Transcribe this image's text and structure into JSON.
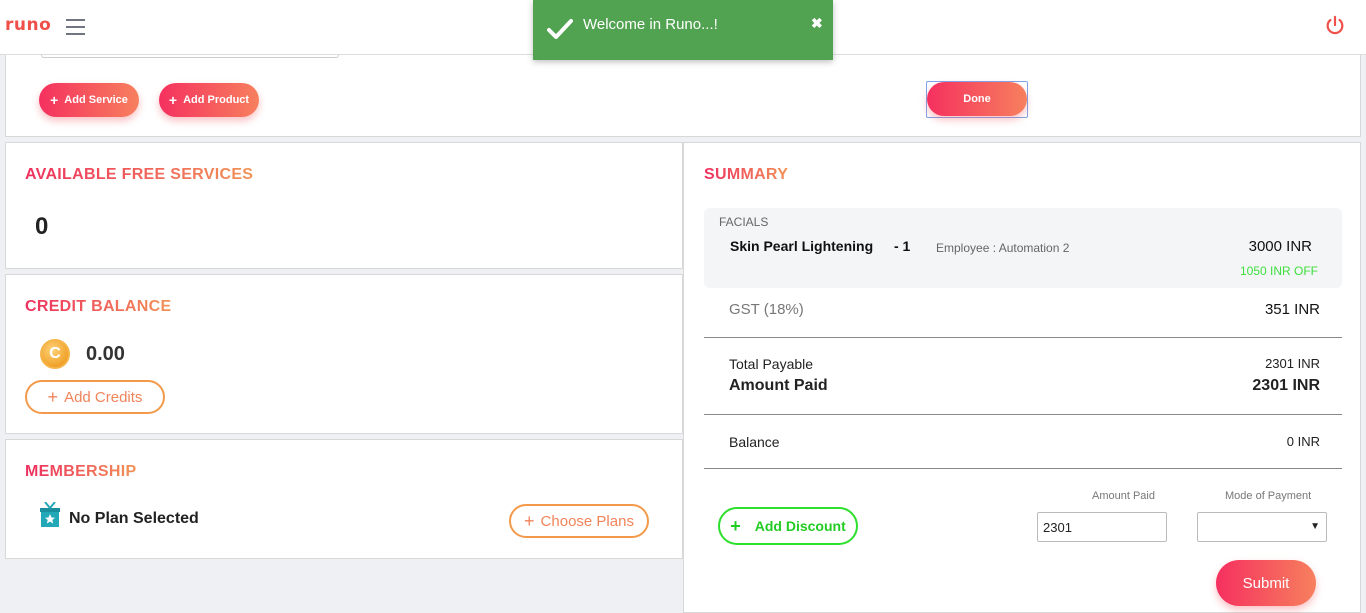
{
  "header": {
    "logo": "runo",
    "menu_icon": "hamburger-icon",
    "power_icon": "power-icon"
  },
  "toast": {
    "message": "Welcome in Runo...!",
    "close": "✖",
    "color": "#51a351"
  },
  "actions": {
    "add_service": "Add Service",
    "add_product": "Add Product",
    "done": "Done"
  },
  "free_services": {
    "title": "AVAILABLE FREE SERVICES",
    "count": "0"
  },
  "credit_balance": {
    "title": "CREDIT BALANCE",
    "coin_letter": "C",
    "value": "0.00",
    "add_credits": "Add Credits"
  },
  "membership": {
    "title": "MEMBERSHIP",
    "plan": "No Plan Selected",
    "choose_plans": "Choose Plans"
  },
  "summary": {
    "title": "SUMMARY",
    "category": "FACIALS",
    "service": "Skin Pearl Lightening",
    "qty": "-  1",
    "employee": "Employee : Automation 2",
    "price": "3000  INR",
    "discount_off": "1050 INR OFF",
    "gst_label": "GST (18%)",
    "gst_value": "351  INR",
    "total_payable_label": "Total Payable",
    "total_payable_value": "2301 INR",
    "amount_paid_label": "Amount Paid",
    "amount_paid_value": "2301 INR",
    "balance_label": "Balance",
    "balance_value": "0 INR",
    "add_discount": "Add Discount",
    "amount_paid_field_label": "Amount Paid",
    "amount_paid_input": "2301",
    "mode_of_payment_label": "Mode of Payment",
    "mode_of_payment_value": "",
    "submit": "Submit"
  },
  "colors": {
    "accent_start": "#f5305f",
    "accent_end": "#f7805e",
    "discount_green": "#2ee02e"
  }
}
